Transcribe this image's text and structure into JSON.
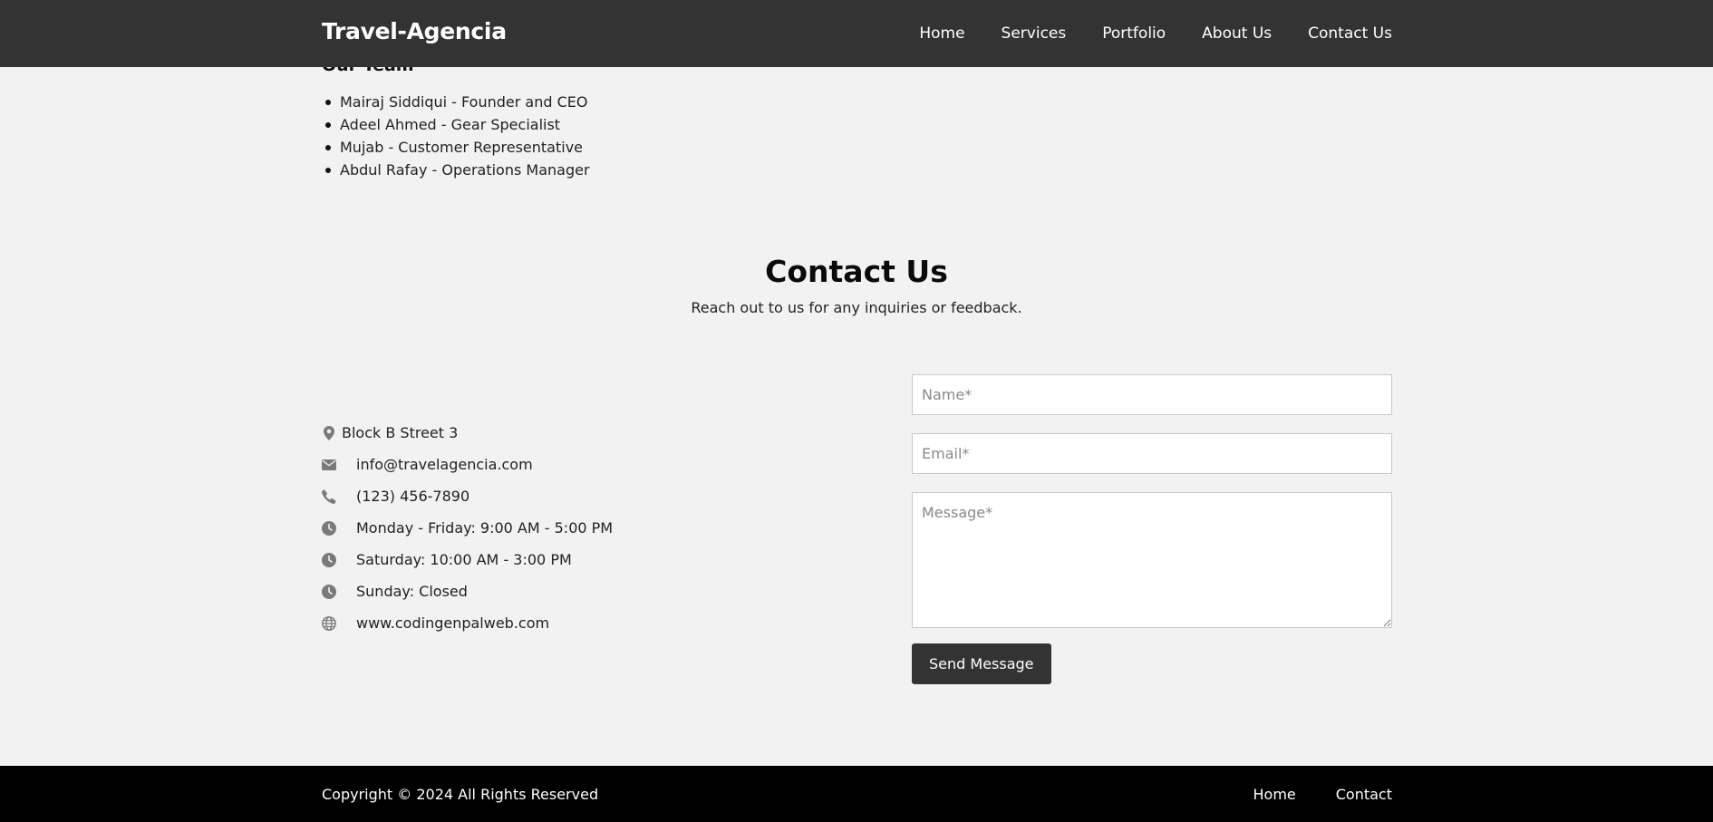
{
  "header": {
    "logo": "Travel-Agencia",
    "nav": [
      {
        "label": "Home"
      },
      {
        "label": "Services"
      },
      {
        "label": "Portfolio"
      },
      {
        "label": "About Us"
      },
      {
        "label": "Contact Us"
      }
    ]
  },
  "team": {
    "heading": "Our Team",
    "members": [
      "Mairaj Siddiqui - Founder and CEO",
      "Adeel Ahmed - Gear Specialist",
      "Mujab - Customer Representative",
      "Abdul Rafay - Operations Manager"
    ]
  },
  "contact": {
    "title": "Contact Us",
    "subtitle": "Reach out to us for any inquiries or feedback.",
    "info": [
      {
        "icon": "map-pin-icon",
        "text": "Block B Street 3"
      },
      {
        "icon": "envelope-icon",
        "text": "info@travelagencia.com"
      },
      {
        "icon": "phone-icon",
        "text": "(123) 456-7890"
      },
      {
        "icon": "clock-icon",
        "text": "Monday - Friday: 9:00 AM - 5:00 PM"
      },
      {
        "icon": "clock-icon",
        "text": "Saturday: 10:00 AM - 3:00 PM"
      },
      {
        "icon": "clock-icon",
        "text": "Sunday: Closed"
      },
      {
        "icon": "globe-icon",
        "text": "www.codingenpalweb.com"
      }
    ],
    "form": {
      "name_placeholder": "Name*",
      "email_placeholder": "Email*",
      "message_placeholder": "Message*",
      "name_value": "",
      "email_value": "",
      "message_value": "",
      "submit_label": "Send Message"
    }
  },
  "footer": {
    "copyright": "Copyright © 2024 All Rights Reserved",
    "links": [
      {
        "label": "Home"
      },
      {
        "label": "Contact"
      }
    ]
  },
  "colors": {
    "header_bg": "#333333",
    "page_bg": "#f2f2f2",
    "footer_bg": "#000000",
    "button_bg": "#333333",
    "icon_gray": "#7a7a7a"
  }
}
